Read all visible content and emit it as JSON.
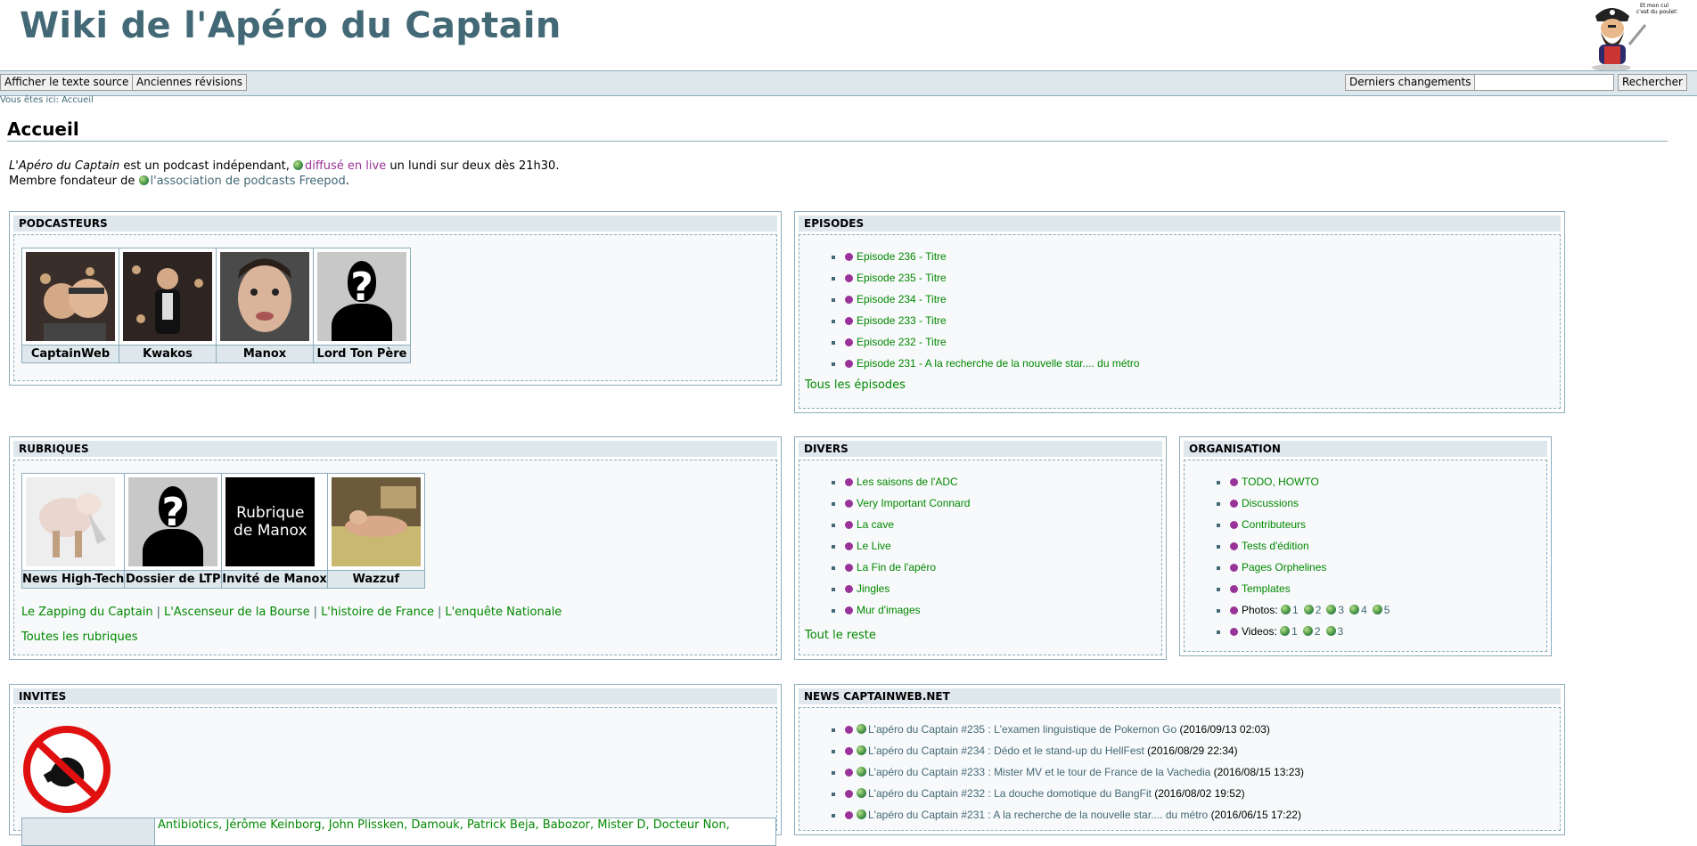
{
  "header": {
    "site_title": "Wiki de l'Apéro du Captain",
    "logo_caption": "Et mon cul c'est du poulet?"
  },
  "toolbar": {
    "show_source": "Afficher le texte source",
    "old_revisions": "Anciennes révisions",
    "recent_changes": "Derniers changements",
    "search_button": "Rechercher",
    "search_value": ""
  },
  "breadcrumb": {
    "label": "Vous êtes ici:",
    "current": "Accueil"
  },
  "page": {
    "title": "Accueil",
    "intro": {
      "show_name": "L'Apéro du Captain",
      "text1": " est un podcast indépendant, ",
      "live_link": "diffusé en live",
      "text2": " un lundi sur deux dès 21h30.",
      "text3": "Membre fondateur de ",
      "freepod_link": "l'association de podcasts Freepod",
      "text4": "."
    }
  },
  "podcasteurs": {
    "title": "PODCASTEURS",
    "members": [
      "CaptainWeb",
      "Kwakos",
      "Manox",
      "Lord Ton Père"
    ]
  },
  "episodes": {
    "title": "EPISODES",
    "items": [
      "Episode 236 - Titre",
      "Episode 235 - Titre",
      "Episode 234 - Titre",
      "Episode 233 - Titre",
      "Episode 232 - Titre",
      "Episode 231 - A la recherche de la nouvelle star.... du métro"
    ],
    "all_link": "Tous les épisodes"
  },
  "rubriques": {
    "title": "RUBRIQUES",
    "items": [
      "News High-Tech",
      "Dossier de LTP",
      "Invité de Manox",
      "Wazzuf"
    ],
    "manox_box_text": "Rubrique de Manox",
    "links": [
      "Le Zapping du Captain",
      "L'Ascenseur de la Bourse",
      "L'histoire de France",
      "L'enquête Nationale"
    ],
    "all_link": "Toutes les rubriques"
  },
  "divers": {
    "title": "DIVERS",
    "items": [
      "Les saisons de l'ADC",
      "Very Important Connard",
      "La cave",
      "Le Live",
      "La Fin de l'apéro",
      "Jingles",
      "Mur d'images"
    ],
    "all_link": "Tout le reste"
  },
  "organisation": {
    "title": "ORGANISATION",
    "items": [
      "TODO, HOWTO",
      "Discussions",
      "Contributeurs",
      "Tests d'édition",
      "Pages Orphelines",
      "Templates"
    ],
    "photos_label": "Photos:",
    "photos": [
      "1",
      "2",
      "3",
      "4",
      "5"
    ],
    "videos_label": "Videos:",
    "videos": [
      "1",
      "2",
      "3"
    ]
  },
  "invites": {
    "title": "INVITES",
    "names_line": "Antibiotics, Jérôme Keinborg, John Plissken, Damouk, Patrick Beja, Babozor, Mister D, Docteur Non,"
  },
  "news": {
    "title": "NEWS CAPTAINWEB.NET",
    "items": [
      {
        "title": "L'apéro du Captain #235 : L'examen linguistique de Pokemon Go",
        "date": "(2016/09/13 02:03)"
      },
      {
        "title": "L'apéro du Captain #234 : Dédo et le stand-up du HellFest",
        "date": "(2016/08/29 22:34)"
      },
      {
        "title": "L'apéro du Captain #233 : Mister MV et le tour de France de la Vachedia",
        "date": "(2016/08/15 13:23)"
      },
      {
        "title": "L'apéro du Captain #232 : La douche domotique du BangFit",
        "date": "(2016/08/02 19:52)"
      },
      {
        "title": "L'apéro du Captain #231 : A la recherche de la nouvelle star.... du métro",
        "date": "(2016/06/15 17:22)"
      }
    ]
  },
  "colors": {
    "link": "#008800",
    "visited": "#993399",
    "title": "#436976",
    "panel_head": "#dee7ec"
  }
}
